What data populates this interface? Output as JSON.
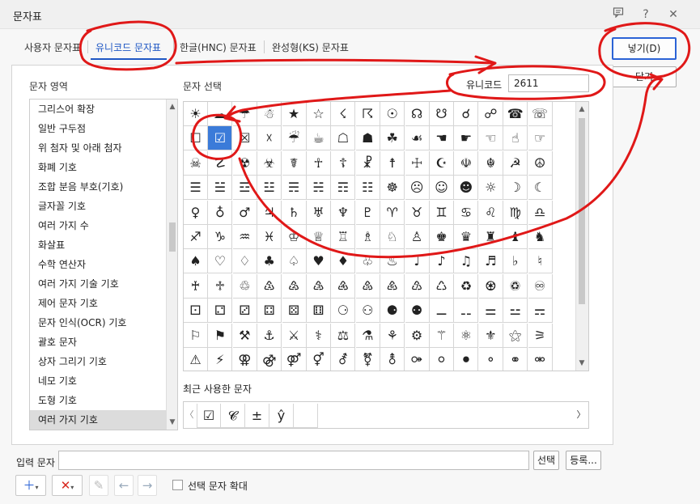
{
  "window": {
    "title": "문자표"
  },
  "tabs": [
    "사용자 문자표",
    "유니코드 문자표",
    "한글(HNC) 문자표",
    "완성형(KS) 문자표"
  ],
  "labels": {
    "area": "문자 영역",
    "select": "문자 선택",
    "unicode": "유니코드",
    "recent": "최근 사용한 문자",
    "input": "입력 문자",
    "enlarge": "선택 문자 확대"
  },
  "unicode_value": "2611",
  "buttons": {
    "insert": "넣기(D)",
    "close": "닫기",
    "select": "선택",
    "register": "등록..."
  },
  "areas": [
    "그리스어 확장",
    "일반 구두점",
    "위 첨자 및 아래 첨자",
    "화폐 기호",
    "조합 분음 부호(기호)",
    "글자꼴 기호",
    "여러 가지 수",
    "화살표",
    "수학 연산자",
    "여러 가지 기술 기호",
    "제어 문자 기호",
    "문자 인식(OCR) 기호",
    "괄호 문자",
    "상자 그리기 기호",
    "네모 기호",
    "도형 기호",
    "여러 가지 기호"
  ],
  "selected_area_index": 16,
  "symbols": [
    [
      "☀",
      "☁",
      "☂",
      "☃",
      "★",
      "☆",
      "☇",
      "☈",
      "☉",
      "☊",
      "☋",
      "☌",
      "☍",
      "☎",
      "☏"
    ],
    [
      "☐",
      "☑",
      "☒",
      "☓",
      "☔",
      "☕",
      "☖",
      "☗",
      "☘",
      "☙",
      "☚",
      "☛",
      "☜",
      "☝",
      "☞"
    ],
    [
      "☠",
      "☡",
      "☢",
      "☣",
      "☤",
      "☥",
      "☦",
      "☧",
      "☨",
      "☩",
      "☪",
      "☫",
      "☬",
      "☭",
      "☮"
    ],
    [
      "☰",
      "☱",
      "☲",
      "☳",
      "☴",
      "☵",
      "☶",
      "☷",
      "☸",
      "☹",
      "☺",
      "☻",
      "☼",
      "☽",
      "☾"
    ],
    [
      "♀",
      "♁",
      "♂",
      "♃",
      "♄",
      "♅",
      "♆",
      "♇",
      "♈",
      "♉",
      "♊",
      "♋",
      "♌",
      "♍",
      "♎"
    ],
    [
      "♐",
      "♑",
      "♒",
      "♓",
      "♔",
      "♕",
      "♖",
      "♗",
      "♘",
      "♙",
      "♚",
      "♛",
      "♜",
      "♝",
      "♞"
    ],
    [
      "♠",
      "♡",
      "♢",
      "♣",
      "♤",
      "♥",
      "♦",
      "♧",
      "♨",
      "♩",
      "♪",
      "♫",
      "♬",
      "♭",
      "♮"
    ],
    [
      "♰",
      "♱",
      "♲",
      "♳",
      "♴",
      "♵",
      "♶",
      "♷",
      "♸",
      "♹",
      "♺",
      "♻",
      "♼",
      "♽",
      "♾"
    ],
    [
      "⚀",
      "⚁",
      "⚂",
      "⚃",
      "⚄",
      "⚅",
      "⚆",
      "⚇",
      "⚈",
      "⚉",
      "⚊",
      "⚋",
      "⚌",
      "⚍",
      "⚎"
    ],
    [
      "⚐",
      "⚑",
      "⚒",
      "⚓",
      "⚔",
      "⚕",
      "⚖",
      "⚗",
      "⚘",
      "⚙",
      "⚚",
      "⚛",
      "⚜",
      "⚝",
      "⚞"
    ],
    [
      "⚠",
      "⚡",
      "⚢",
      "⚣",
      "⚤",
      "⚥",
      "⚦",
      "⚧",
      "⚨",
      "⚩",
      "⚪",
      "⚫",
      "⚬",
      "⚭",
      "⚮"
    ]
  ],
  "selected_symbol": {
    "row": 1,
    "col": 1
  },
  "recent": [
    "☑",
    "𝓒",
    "±",
    "ŷ"
  ],
  "colors": {
    "accent": "#1f57c4",
    "selection": "#3b7bd9",
    "annotation": "#e01818"
  }
}
